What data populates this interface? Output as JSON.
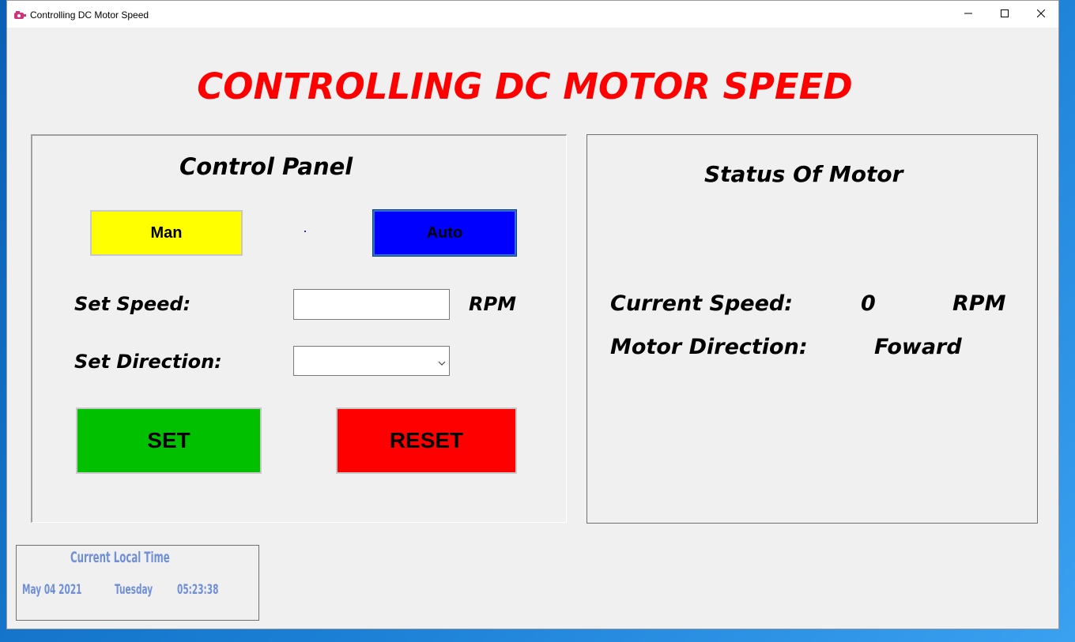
{
  "window": {
    "title": "Controlling DC Motor Speed"
  },
  "header": {
    "title": "CONTROLLING DC MOTOR SPEED"
  },
  "control_panel": {
    "title": "Control Panel",
    "man_label": "Man",
    "auto_label": "Auto",
    "set_speed_label": "Set Speed:",
    "speed_value": "",
    "speed_unit": "RPM",
    "set_direction_label": "Set Direction:",
    "direction_value": "",
    "set_label": "SET",
    "reset_label": "RESET"
  },
  "status_panel": {
    "title": "Status Of Motor",
    "current_speed_label": "Current Speed:",
    "current_speed_value": "0",
    "current_speed_unit": "RPM",
    "motor_direction_label": "Motor Direction:",
    "motor_direction_value": "Foward"
  },
  "clock": {
    "title": "Current Local Time",
    "date": "May 04 2021",
    "day": "Tuesday",
    "time": "05:23:38"
  },
  "colors": {
    "title_red": "#ff0000",
    "man_button": "#ffff00",
    "auto_button": "#0000ff",
    "set_button": "#00c000",
    "reset_button": "#ff0000",
    "clock_text": "#6f8fd8"
  },
  "icons": [
    "app-motor-icon",
    "minimize-icon",
    "maximize-icon",
    "close-icon",
    "chevron-down-icon"
  ]
}
